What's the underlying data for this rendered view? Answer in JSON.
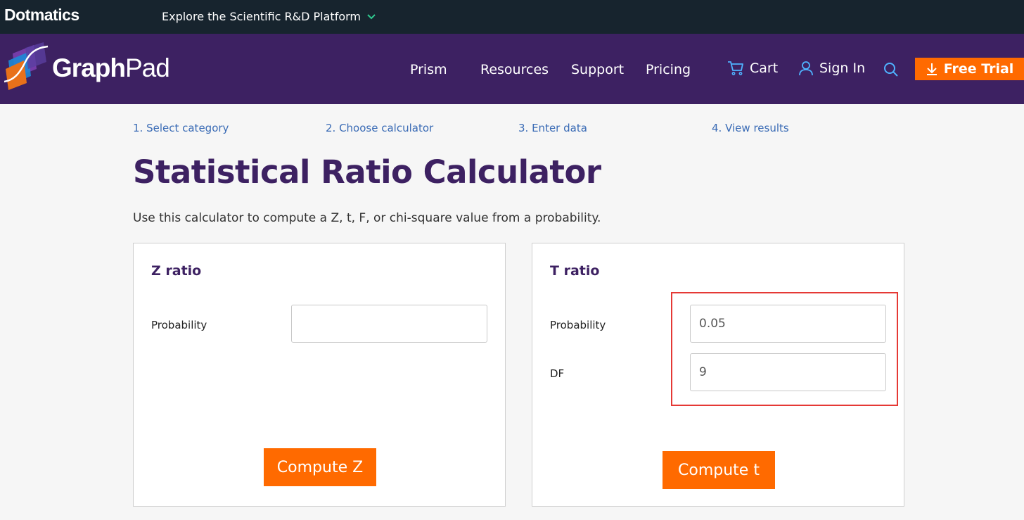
{
  "topbar": {
    "brand": "Dotmatics",
    "explore": "Explore the Scientific R&D Platform"
  },
  "nav": {
    "logo_graph": "Graph",
    "logo_pad": "Pad",
    "items": [
      "Prism",
      "Resources",
      "Support",
      "Pricing"
    ],
    "cart": "Cart",
    "sign_in": "Sign In",
    "free_trial": "Free Trial"
  },
  "steps": [
    "1. Select category",
    "2. Choose calculator",
    "3. Enter data",
    "4. View results"
  ],
  "page": {
    "title": "Statistical Ratio Calculator",
    "intro": "Use this calculator to compute a Z, t, F, or chi-square value from a probability."
  },
  "z_panel": {
    "title": "Z ratio",
    "probability_label": "Probability",
    "probability_value": "",
    "button": "Compute Z"
  },
  "t_panel": {
    "title": "T ratio",
    "probability_label": "Probability",
    "probability_value": "0.05",
    "df_label": "DF",
    "df_value": "9",
    "button": "Compute t"
  },
  "colors": {
    "topbar": "#17242e",
    "nav": "#3d2162",
    "accent": "#ff6a00",
    "link": "#3a6bb5",
    "highlight": "#e53935"
  }
}
